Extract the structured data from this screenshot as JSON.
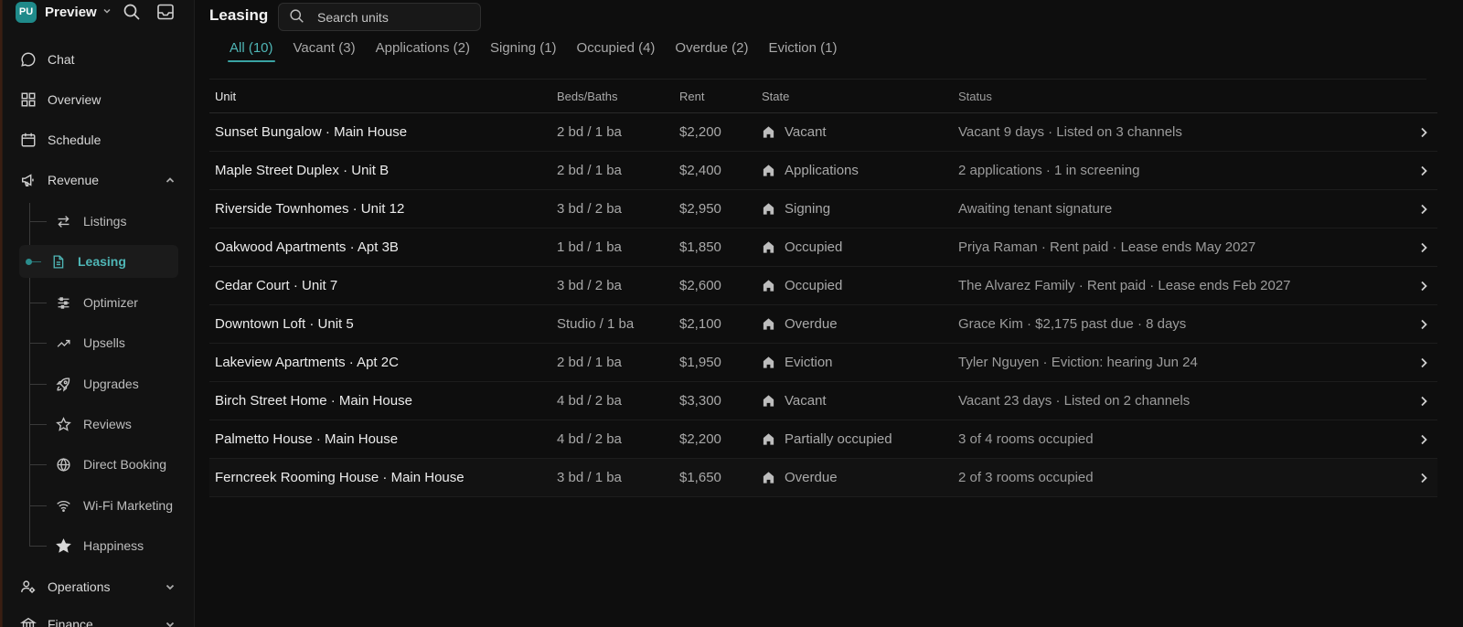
{
  "workspace": {
    "initials": "PU",
    "name": "Preview"
  },
  "sidebar": {
    "chat": "Chat",
    "overview": "Overview",
    "schedule": "Schedule",
    "revenue": "Revenue",
    "revenue_items": [
      "Listings",
      "Leasing",
      "Optimizer",
      "Upsells",
      "Upgrades",
      "Reviews",
      "Direct Booking",
      "Wi-Fi Marketing",
      "Happiness"
    ],
    "operations": "Operations",
    "finance": "Finance"
  },
  "header": {
    "title": "Leasing",
    "search_placeholder": "Search units"
  },
  "tabs": [
    "All (10)",
    "Vacant (3)",
    "Applications (2)",
    "Signing (1)",
    "Occupied (4)",
    "Overdue (2)",
    "Eviction (1)"
  ],
  "table": {
    "columns": {
      "unit": "Unit",
      "beds": "Beds/Baths",
      "rent": "Rent",
      "state": "State",
      "status": "Status"
    },
    "rows": [
      {
        "unit": "Sunset Bungalow · Main House",
        "beds": "2 bd / 1 ba",
        "rent": "$2,200",
        "state": "Vacant",
        "status": "Vacant 9 days · Listed on 3 channels"
      },
      {
        "unit": "Maple Street Duplex · Unit B",
        "beds": "2 bd / 1 ba",
        "rent": "$2,400",
        "state": "Applications",
        "status": "2 applications · 1 in screening"
      },
      {
        "unit": "Riverside Townhomes · Unit 12",
        "beds": "3 bd / 2 ba",
        "rent": "$2,950",
        "state": "Signing",
        "status": "Awaiting tenant signature"
      },
      {
        "unit": "Oakwood Apartments · Apt 3B",
        "beds": "1 bd / 1 ba",
        "rent": "$1,850",
        "state": "Occupied",
        "status": "Priya Raman · Rent paid · Lease ends May 2027"
      },
      {
        "unit": "Cedar Court · Unit 7",
        "beds": "3 bd / 2 ba",
        "rent": "$2,600",
        "state": "Occupied",
        "status": "The Alvarez Family · Rent paid · Lease ends Feb 2027"
      },
      {
        "unit": "Downtown Loft · Unit 5",
        "beds": "Studio / 1 ba",
        "rent": "$2,100",
        "state": "Overdue",
        "status": "Grace Kim · $2,175 past due · 8 days"
      },
      {
        "unit": "Lakeview Apartments · Apt 2C",
        "beds": "2 bd / 1 ba",
        "rent": "$1,950",
        "state": "Eviction",
        "status": "Tyler Nguyen · Eviction: hearing Jun 24"
      },
      {
        "unit": "Birch Street Home · Main House",
        "beds": "4 bd / 2 ba",
        "rent": "$3,300",
        "state": "Vacant",
        "status": "Vacant 23 days · Listed on 2 channels"
      },
      {
        "unit": "Palmetto House · Main House",
        "beds": "4 bd / 2 ba",
        "rent": "$2,200",
        "state": "Partially occupied",
        "status": "3 of 4 rooms occupied"
      },
      {
        "unit": "Ferncreek Rooming House · Main House",
        "beds": "3 bd / 1 ba",
        "rent": "$1,650",
        "state": "Overdue",
        "status": "2 of 3 rooms occupied"
      }
    ]
  },
  "colors": {
    "accent": "#4fb6b6",
    "background": "#0e0e0e",
    "sidebar": "#121212"
  }
}
